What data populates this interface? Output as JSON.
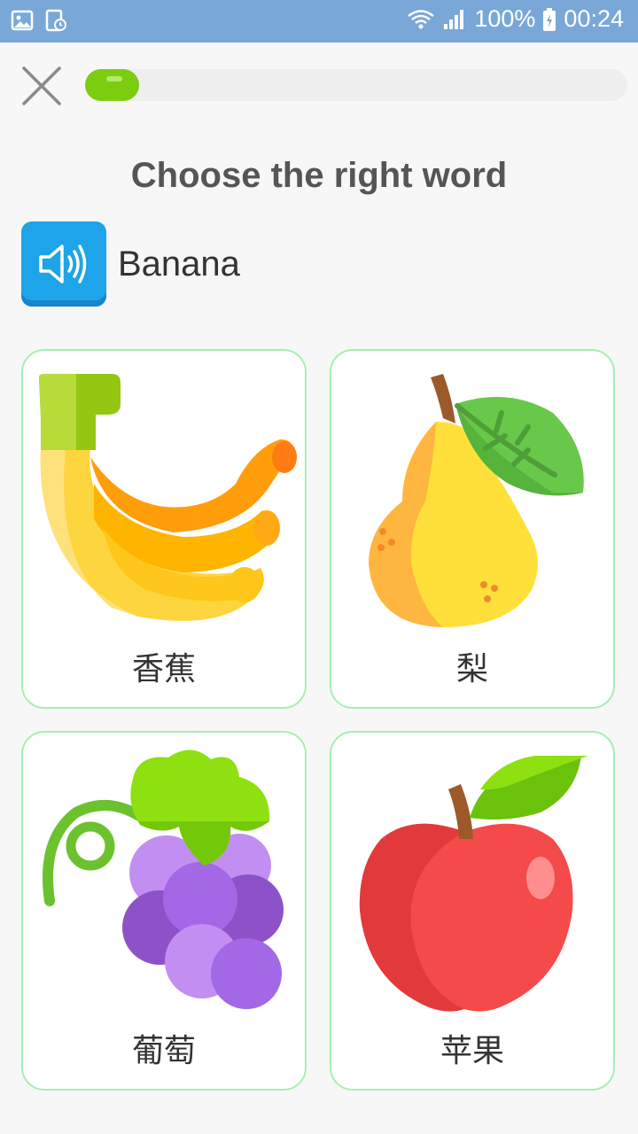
{
  "status_bar": {
    "battery": "100%",
    "time": "00:24"
  },
  "progress": {
    "fraction": 0.1
  },
  "title": "Choose the right word",
  "prompt": {
    "word": "Banana"
  },
  "options": [
    {
      "label": "香蕉",
      "icon": "banana-icon"
    },
    {
      "label": "梨",
      "icon": "pear-icon"
    },
    {
      "label": "葡萄",
      "icon": "grapes-icon"
    },
    {
      "label": "苹果",
      "icon": "apple-icon"
    }
  ],
  "colors": {
    "status_bar": "#79a8d8",
    "progress": "#7ccc10",
    "audio_button": "#1ea4e8",
    "card_border": "#a6eeb2"
  }
}
